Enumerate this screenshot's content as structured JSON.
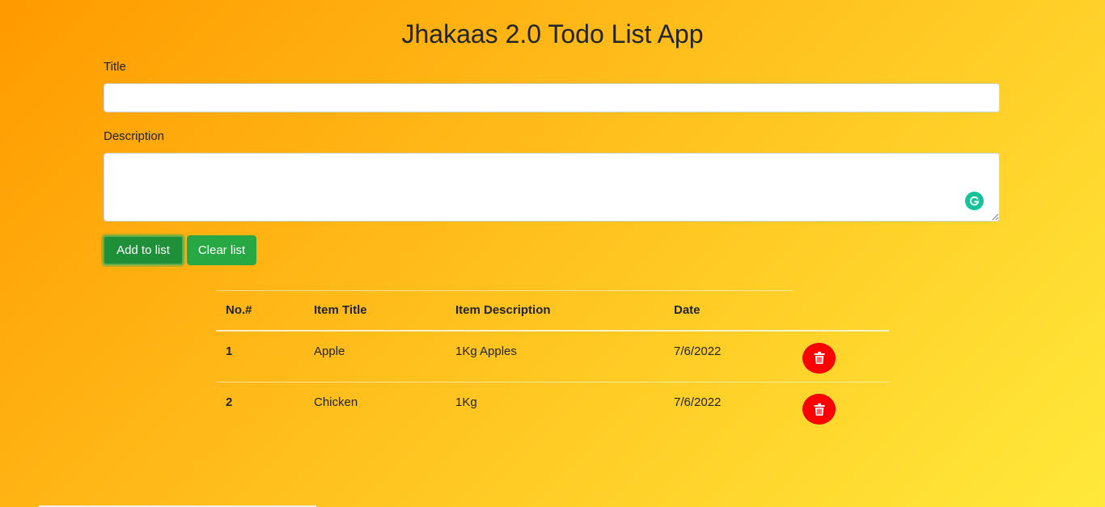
{
  "app": {
    "title": "Jhakaas 2.0 Todo List App"
  },
  "form": {
    "title_label": "Title",
    "title_value": "",
    "description_label": "Description",
    "description_value": "",
    "add_button": "Add to list",
    "clear_button": "Clear list"
  },
  "table": {
    "headers": [
      "No.#",
      "Item Title",
      "Item Description",
      "Date"
    ],
    "rows": [
      {
        "no": "1",
        "title": "Apple",
        "description": "1Kg Apples",
        "date": "7/6/2022"
      },
      {
        "no": "2",
        "title": "Chicken",
        "description": "1Kg",
        "date": "7/6/2022"
      }
    ]
  },
  "icons": {
    "delete": "trash-icon",
    "grammarly": "grammarly-icon"
  },
  "colors": {
    "add_button": "#1f8f3a",
    "clear_button": "#28a745",
    "delete_button": "#ff0000",
    "gradient_start": "#ff9a00",
    "gradient_end": "#ffe93a"
  }
}
